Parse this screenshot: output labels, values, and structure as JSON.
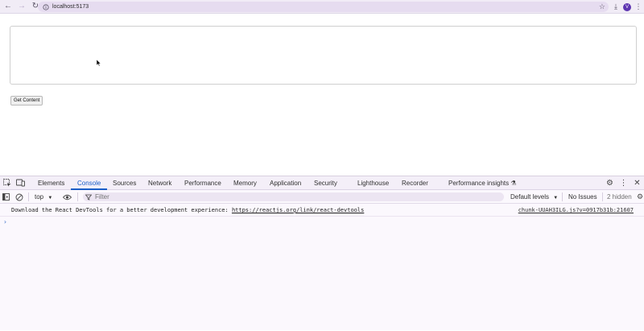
{
  "browser": {
    "url": "localhost:5173",
    "avatar_letter": "V"
  },
  "page": {
    "button_label": "Get Content"
  },
  "devtools": {
    "tabs": [
      {
        "label": "Elements"
      },
      {
        "label": "Console"
      },
      {
        "label": "Sources"
      },
      {
        "label": "Network"
      },
      {
        "label": "Performance"
      },
      {
        "label": "Memory"
      },
      {
        "label": "Application"
      },
      {
        "label": "Security"
      },
      {
        "label": "Lighthouse"
      },
      {
        "label": "Recorder"
      },
      {
        "label": "Performance insights"
      }
    ],
    "active_tab": "Console",
    "toolbar": {
      "context": "top",
      "filter_placeholder": "Filter",
      "levels": "Default levels",
      "issues": "No Issues",
      "hidden": "2 hidden"
    },
    "console": {
      "message_text": "Download the React DevTools for a better development experience: ",
      "message_link": "https://reactjs.org/link/react-devtools",
      "message_source": "chunk-UUAH3ILG.js?v=0917b31b:21607",
      "prompt": "›"
    }
  },
  "colors": {
    "accent": "#1b5ec8",
    "avatar": "#5e35b1"
  }
}
